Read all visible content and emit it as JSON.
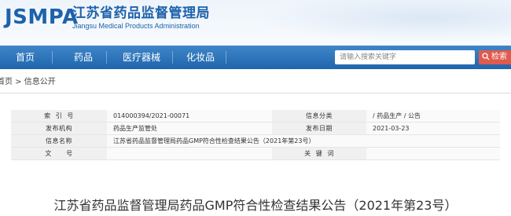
{
  "header": {
    "logo_abbr": "JSMPA",
    "org_name_cn": "江苏省药品监督管理局",
    "org_name_en": "Jiangsu Medical Products Administration"
  },
  "nav": {
    "items": [
      "首页",
      "药品",
      "医疗器械",
      "化妆品"
    ],
    "search_placeholder": "请输入搜索关键字",
    "search_button": "检索"
  },
  "breadcrumb": {
    "home": "首页",
    "separator": " > ",
    "current": "信息公开"
  },
  "info_table": {
    "rows": [
      {
        "label1": "索  引  号",
        "value1": "014000394/2021-00071",
        "label2": "信息分类",
        "value2": "/ 药品生产 / 公告"
      },
      {
        "label1": "发布机构",
        "value1": "药品生产监管处",
        "label2": "发布日期",
        "value2": "2021-03-23"
      },
      {
        "label1": "信息名称",
        "value1": "江苏省药品监督管理局药品GMP符合性检查结果公告（2021年第23号）",
        "label2": "",
        "value2": ""
      },
      {
        "label1": "文      号",
        "value1": "",
        "label2": "关  键  词",
        "value2": ""
      }
    ]
  },
  "document": {
    "title": "江苏省药品监督管理局药品GMP符合性检查结果公告（2021年第23号）"
  },
  "colors": {
    "brand_blue": "#1d62ab",
    "nav_blue": "#2a70b8",
    "search_red": "#e05a4e"
  }
}
